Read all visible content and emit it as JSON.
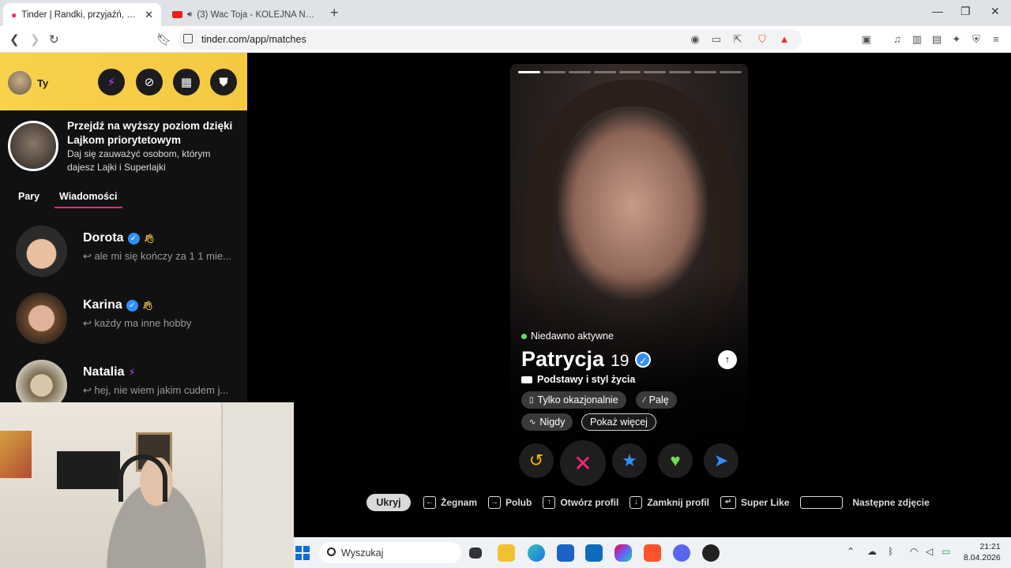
{
  "browser": {
    "tabs": [
      {
        "title": "Tinder | Randki, przyjaźń, nowe z",
        "close": "✕"
      },
      {
        "title": "(3) Wac Toja - KOLEJNA NOC (Si"
      }
    ],
    "url": "tinder.com/app/matches"
  },
  "sidebar": {
    "user_name": "Ty",
    "promo_title": "Przejdź na wyższy poziom dzięki Lajkom priorytetowym",
    "promo_subtitle": "Daj się zauważyć osobom, którym dajesz Lajki i Superlajki",
    "tabs": [
      {
        "label": "Pary"
      },
      {
        "label": "Wiadomości"
      }
    ],
    "messages": [
      {
        "name": "Dorota",
        "preview": "ale mi się kończy za 1 1 mie...",
        "verified": true
      },
      {
        "name": "Karina",
        "preview": "każdy ma inne hobby",
        "verified": true
      },
      {
        "name": "Natalia",
        "preview": "hej, nie wiem jakim cudem j...",
        "verified": false
      }
    ]
  },
  "profile": {
    "status": "Niedawno aktywne",
    "name": "Patrycja",
    "age": "19",
    "section_label": "Podstawy i styl życia",
    "chips": [
      "Tylko okazjonalnie",
      "Palę",
      "Nigdy"
    ],
    "show_more": "Pokaż więcej",
    "photo_count": 9,
    "current_photo": 1
  },
  "shortcuts": {
    "hide": "Ukryj",
    "items": [
      {
        "key": "←",
        "label": "Żegnam"
      },
      {
        "key": "→",
        "label": "Polub"
      },
      {
        "key": "↑",
        "label": "Otwórz profil"
      },
      {
        "key": "↓",
        "label": "Zamknij profil"
      },
      {
        "key": "↵",
        "label": "Super Like"
      }
    ],
    "next_photo": "Następne zdjęcie"
  },
  "taskbar": {
    "search_placeholder": "Wyszukaj",
    "time": "21:21",
    "date": "8.04.2026"
  },
  "colors": {
    "tinder_pink": "#fd267a",
    "gold": "#f5c842",
    "verified_blue": "#2f8fff",
    "online_green": "#5fe05f"
  }
}
